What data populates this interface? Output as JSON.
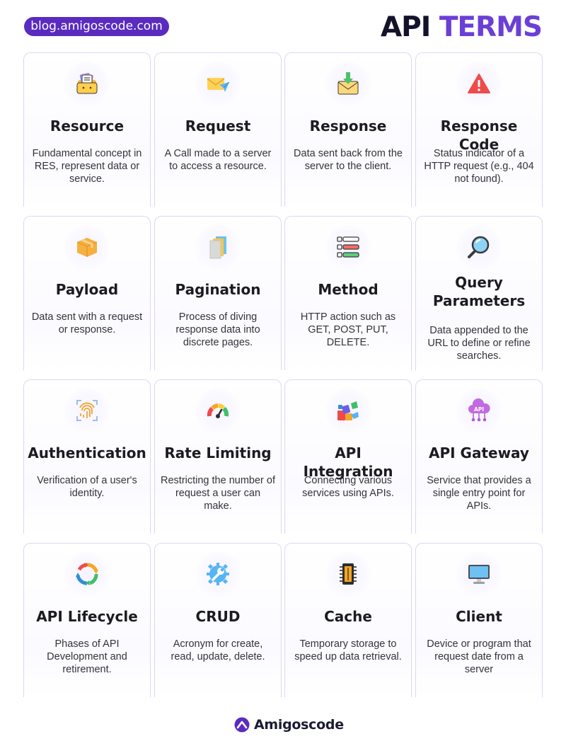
{
  "header": {
    "blog_url": "blog.amigoscode.com",
    "title_part1": "API",
    "title_part2": "TERMS"
  },
  "colors": {
    "accent": "#6b3fd6",
    "pill": "#5a2bbf",
    "card_border": "#ddd6f3"
  },
  "cards": [
    {
      "icon": "folder-documents-icon",
      "title": "Resource",
      "description": "Fundamental concept in RES, represent data or service."
    },
    {
      "icon": "envelope-send-icon",
      "title": "Request",
      "description": "A Call made to a server to access a resource."
    },
    {
      "icon": "envelope-download-icon",
      "title": "Response",
      "description": "Data sent back from the server to the client."
    },
    {
      "icon": "warning-icon",
      "title": "Response Code",
      "description": "Status indicator of a HTTP request (e.g., 404 not found)."
    },
    {
      "icon": "package-box-icon",
      "title": "Payload",
      "description": "Data sent with a request or response."
    },
    {
      "icon": "pages-stack-icon",
      "title": "Pagination",
      "description": "Process of diving response data into discrete pages."
    },
    {
      "icon": "method-list-icon",
      "title": "Method",
      "description": "HTTP action such as GET, POST, PUT, DELETE."
    },
    {
      "icon": "magnifier-icon",
      "title": "Query Parameters",
      "description": "Data appended to the URL to define or refine searches."
    },
    {
      "icon": "fingerprint-icon",
      "title": "Authentication",
      "description": "Verification of a user's identity."
    },
    {
      "icon": "speedometer-icon",
      "title": "Rate Limiting",
      "description": "Restricting the number of request a user can make."
    },
    {
      "icon": "puzzle-pieces-icon",
      "title": "API Integration",
      "description": "Connecting various services using APIs."
    },
    {
      "icon": "api-cloud-icon",
      "title": "API Gateway",
      "description": "Service that provides a single entry point for APIs."
    },
    {
      "icon": "lifecycle-arrows-icon",
      "title": "API Lifecycle",
      "description": "Phases of API Development and retirement."
    },
    {
      "icon": "gear-wrench-icon",
      "title": "CRUD",
      "description": "Acronym for create, read, update, delete."
    },
    {
      "icon": "memory-chip-icon",
      "title": "Cache",
      "description": "Temporary storage to speed up data retrieval."
    },
    {
      "icon": "computer-monitor-icon",
      "title": "Client",
      "description": "Device or program that request date from a server"
    }
  ],
  "footer": {
    "brand": "Amigoscode"
  }
}
